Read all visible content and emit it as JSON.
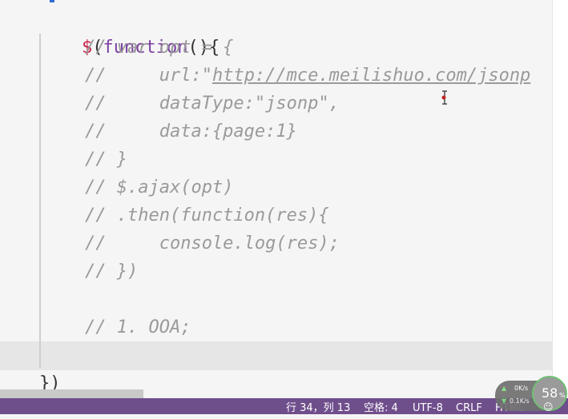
{
  "code": {
    "line_open": {
      "dollar": "$",
      "keyword": "function",
      "punct": "(",
      "rest": "(){"
    },
    "comment_lines": [
      "// var opt = {",
      "//     url:\"",
      "//     dataType:\"jsonp\",",
      "//     data:{page:1}",
      "// }",
      "// $.ajax(opt)",
      "// .then(function(res){",
      "//     console.log(res);",
      "// })",
      "",
      "// 1. OOA;"
    ],
    "url_text": "http://mce.meilishuo.com/jsonp",
    "line_close": "})"
  },
  "status_bar": {
    "position": "行 34，列 13",
    "spaces": "空格: 4",
    "encoding": "UTF-8",
    "eol": "CRLF",
    "language": "HTML",
    "bg_color": "#6f4e8c"
  },
  "net_monitor": {
    "up": "0K/s",
    "down": "0.1K/s",
    "percent": "58",
    "percent_sign": "%"
  },
  "icons": {
    "cursor": "text-cursor-icon",
    "face": "smiley-face-icon"
  }
}
